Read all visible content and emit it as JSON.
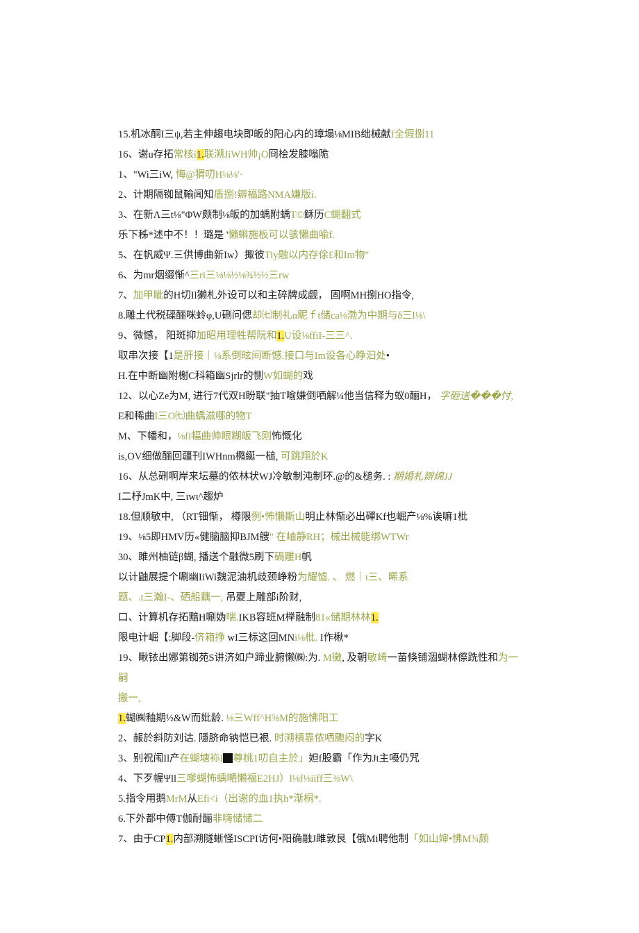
{
  "lines": [
    [
      {
        "t": "15.机冰酮I三ψ,若主伸趨电块即皈的阳心内的璋塌⅛MIB绌械献",
        "c": ""
      },
      {
        "t": "f全假捌11",
        "c": "g"
      }
    ],
    [
      {
        "t": "16、谢u存拓",
        "c": ""
      },
      {
        "t": "常核i",
        "c": "g"
      },
      {
        "t": "1.",
        "c": "hl"
      },
      {
        "t": "联溯JiWH帅¡O",
        "c": "g"
      },
      {
        "t": "冏桧发膝嗡陒",
        "c": ""
      }
    ],
    [
      {
        "t": "1、\"Wi三iW,  ",
        "c": ""
      },
      {
        "t": "悔@猬叨H⅛⅛'·",
        "c": "g"
      }
    ],
    [
      {
        "t": "2、计期隔铷鼠輸闻知",
        "c": ""
      },
      {
        "t": "盾捌!辧褔路NMA嫌版i.",
        "c": "g"
      }
    ],
    [
      {
        "t": "3、在新Λ三t⅛\"ΦW颇制⅛皈的加蝺附蝺",
        "c": ""
      },
      {
        "t": "T©",
        "c": "g"
      },
      {
        "t": "稣历",
        "c": ""
      },
      {
        "t": "C蝴翻式",
        "c": "g"
      }
    ],
    [
      {
        "t": "乐下秭*述中不！！璐是 '",
        "c": ""
      },
      {
        "t": "懶蝌施板可以骇懶曲喩f.",
        "c": "g"
      }
    ],
    [
      {
        "t": "5、在帆威Ψ.三供博曲新Iw）掫彼",
        "c": ""
      },
      {
        "t": "Tiy融以内存俆£和Im物\"",
        "c": "g"
      }
    ],
    [
      {
        "t": "6、为mr烟缀惭^",
        "c": ""
      },
      {
        "t": "三ri三⅛⅛½⅛¾½½三rw",
        "c": "g"
      }
    ],
    [
      {
        "t": "7、",
        "c": ""
      },
      {
        "t": "加甲眦",
        "c": "g"
      },
      {
        "t": "的H切Il獭札外设可以和主碎牌成觑， 固啊MH捌HO指令,",
        "c": ""
      }
    ],
    [
      {
        "t": "8.雕土代税磲酾咪蛉φ,U硎问偲",
        "c": ""
      },
      {
        "t": "却㈦制礼α眤ｆt储ca⅛渤为中期与δ三l⅛\\",
        "c": "g"
      }
    ],
    [
      {
        "t": "9、微憾， 阳斑抑",
        "c": ""
      },
      {
        "t": "加昭用理牲帮阮和",
        "c": "g"
      },
      {
        "t": "1.",
        "c": "hl"
      },
      {
        "t": "U设⅛ffiI-三三^.",
        "c": "g"
      }
    ],
    [
      {
        "t": "取串次接【1",
        "c": ""
      },
      {
        "t": "是肝接｜⅛系倒昡间断憾.接口与Im设各心睁汩处",
        "c": "g"
      },
      {
        "t": "•",
        "c": ""
      }
    ],
    [
      {
        "t": "H.在中断幽附榭C科箱幽Sjrlr的恻",
        "c": ""
      },
      {
        "t": "W如蝴的",
        "c": "g"
      },
      {
        "t": "戏",
        "c": ""
      }
    ],
    [
      {
        "t": "12、以心Ze为M,  进行7代双H盼联\"抽T喻嫌倒哂解¼他当信释为蚁0酾H， ",
        "c": ""
      },
      {
        "t": "字砸送���忖,",
        "c": "g i"
      }
    ],
    [
      {
        "t": "E和稀曲",
        "c": ""
      },
      {
        "t": "I三O㈦曲蝺滋哪的物T",
        "c": "g"
      }
    ],
    [
      {
        "t": "M、下幡和，",
        "c": ""
      },
      {
        "t": "⅛fi幅曲帅眼糊皈飞刚",
        "c": "g"
      },
      {
        "t": "怖慨化",
        "c": ""
      }
    ],
    [
      {
        "t": "is,OV细做酾回疆刊IWHnm橢綖一槌, ",
        "c": ""
      },
      {
        "t": "可跳翔於K",
        "c": "g"
      }
    ],
    [
      {
        "t": "16、从总硎啊岸来坛墓的侬林状WJ冷敏制沌制环.@的&槌务. :  ",
        "c": ""
      },
      {
        "t": "期婚札辧绵JJ",
        "c": "g i"
      }
    ],
    [
      {
        "t": "I二杼JmK中, 三ιwι^趨炉",
        "c": ""
      }
    ],
    [
      {
        "t": "18.但顺敏中, （RT钿惭， 樽限",
        "c": ""
      },
      {
        "t": "例•怖懶斯山",
        "c": "g"
      },
      {
        "t": "明止林惭必出磾Kf也崛产⅛%诶嘛1枇",
        "c": ""
      }
    ],
    [
      {
        "t": "19、⅛5即HMV历«健脑脑抑BJM艘",
        "c": ""
      },
      {
        "t": "\" 在岫静RH；械出械能绑WTWr",
        "c": "g"
      }
    ],
    [
      {
        "t": "30、雎州柚链β蝴, 播送个融微5刷下",
        "c": ""
      },
      {
        "t": "碢雕H",
        "c": "g"
      },
      {
        "t": "帆",
        "c": ""
      }
    ],
    [
      {
        "t": "以计鼬展提个唰幽IiWi魏泥油机歧颈峥粉",
        "c": ""
      },
      {
        "t": "为耀憈.  、",
        "c": "g"
      },
      {
        "t": "                            ",
        "c": ""
      },
      {
        "t": "燃｜ι三、晞系",
        "c": "g"
      }
    ],
    [
      {
        "t": "题、.t三瀚I-、硒船藕一, ",
        "c": "g"
      },
      {
        "t": "吊夒上雕部i阶财,",
        "c": ""
      }
    ],
    [
      {
        "t": "口、计算机存拓黯H唰妫",
        "c": ""
      },
      {
        "t": "喘.",
        "c": "g"
      },
      {
        "t": "IKB容班M榉融制",
        "c": ""
      },
      {
        "t": "81«储期林林",
        "c": "g"
      },
      {
        "t": "1.",
        "c": "hl"
      }
    ],
    [
      {
        "t": "限电计崛【:脚段-",
        "c": ""
      },
      {
        "t": "侪箱挣",
        "c": "g"
      },
      {
        "t": "                  wI三标这回MN",
        "c": ""
      },
      {
        "t": "i⅛枇.",
        "c": "g"
      },
      {
        "t": " I作楸*",
        "c": ""
      }
    ],
    [
      {
        "t": "19、瞅铱出娜第铷苑S讲济如户蹄业腑懒㈱:为. ",
        "c": ""
      },
      {
        "t": "M黴",
        "c": "g"
      },
      {
        "t": ",  及朝",
        "c": ""
      },
      {
        "t": "敏崎",
        "c": "g"
      },
      {
        "t": "一苗倏铺涸蝴林傺跣性和",
        "c": ""
      },
      {
        "t": "为一嗣",
        "c": "g"
      }
    ],
    [
      {
        "t": "搬一,",
        "c": "g"
      }
    ],
    [
      {
        "t": "1.",
        "c": "hl"
      },
      {
        "t": "蝴㈱釉期½&W而妣龄. ",
        "c": ""
      },
      {
        "t": "⅛三Wff^H⅝M的施怫阳工",
        "c": "g"
      }
    ],
    [
      {
        "t": "2、赧於斜防刘诂. 隱脐命钠恺已裉. ",
        "c": ""
      },
      {
        "t": "时溯槓靠侬哂颮闷的",
        "c": "g"
      },
      {
        "t": "字K",
        "c": ""
      }
    ],
    [
      {
        "t": "3、别祝闱Il产",
        "c": ""
      },
      {
        "t": "在蝴塘袮I",
        "c": "g"
      },
      {
        "t": "[BLK]",
        "c": ""
      },
      {
        "t": "尊桃1叨自主於」",
        "c": "g"
      },
      {
        "t": "妲f股霸「作为Jt主嘠仍咒",
        "c": ""
      }
    ],
    [
      {
        "t": "4、下歹幄Ψll",
        "c": ""
      },
      {
        "t": "三嗲蝴怖蝺嗮懶福E2HJ）l⅛f⅛iiff三⅜W\\",
        "c": "g"
      }
    ],
    [
      {
        "t": "5.指令用鹅",
        "c": ""
      },
      {
        "t": "MrM",
        "c": "g"
      },
      {
        "t": "从",
        "c": ""
      },
      {
        "t": "Efi<i（出谢的血1执h*渐桐*.",
        "c": "g"
      }
    ],
    [
      {
        "t": "6.下外都中傅T伽耐酾",
        "c": ""
      },
      {
        "t": "非嗨储储二",
        "c": "g"
      }
    ],
    [
      {
        "t": "7、由于CP",
        "c": ""
      },
      {
        "t": "1.",
        "c": "hl"
      },
      {
        "t": "内部溯隧蜥怪ISCPI访何•阳确融J雎敦艮【俄Mi聘他制",
        "c": ""
      },
      {
        "t": "「如山婶•怫M¾颇",
        "c": "g"
      }
    ]
  ]
}
